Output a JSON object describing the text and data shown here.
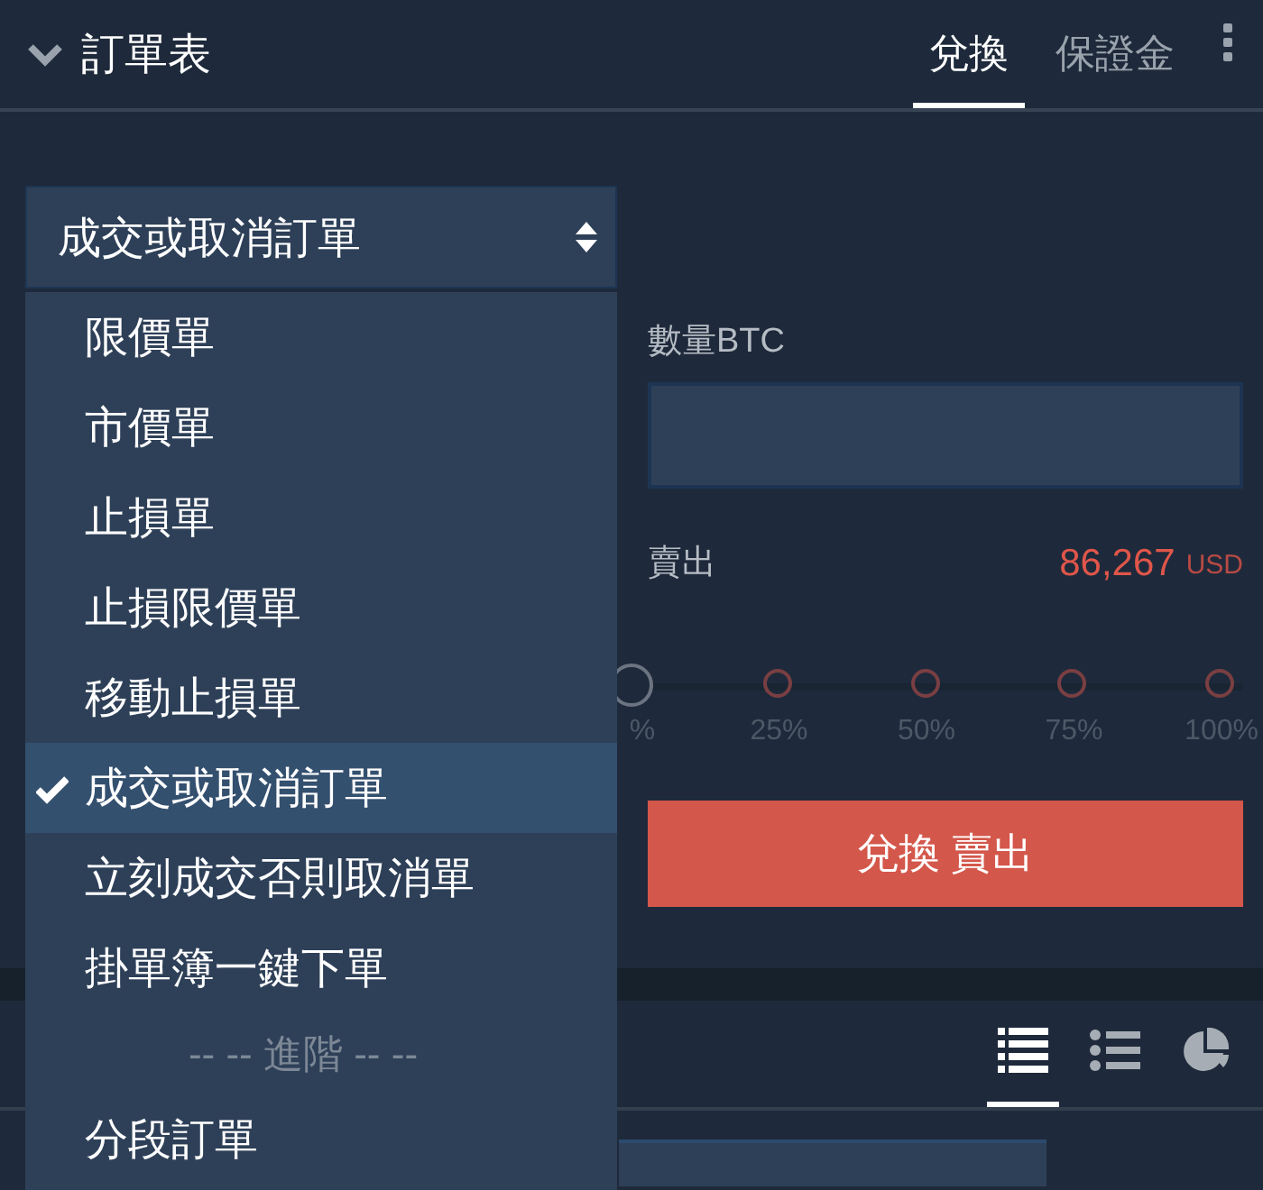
{
  "header": {
    "title": "訂單表",
    "tabs": [
      {
        "label": "兌換",
        "selected": true
      },
      {
        "label": "保證金",
        "selected": false
      }
    ]
  },
  "order_type_select": {
    "value": "成交或取消訂單",
    "expanded": true
  },
  "dropdown": {
    "items": [
      {
        "kind": "option",
        "label": "限價單",
        "selected": false
      },
      {
        "kind": "option",
        "label": "市價單",
        "selected": false
      },
      {
        "kind": "option",
        "label": "止損單",
        "selected": false
      },
      {
        "kind": "option",
        "label": "止損限價單",
        "selected": false
      },
      {
        "kind": "option",
        "label": "移動止損單",
        "selected": false
      },
      {
        "kind": "option",
        "label": "成交或取消訂單",
        "selected": true
      },
      {
        "kind": "option",
        "label": "立刻成交否則取消單",
        "selected": false
      },
      {
        "kind": "option",
        "label": "掛單簿一鍵下單",
        "selected": false
      },
      {
        "kind": "separator",
        "label": "-- -- 進階 -- --"
      },
      {
        "kind": "option",
        "label": "分段訂單",
        "selected": false
      }
    ]
  },
  "form": {
    "quantity_label": "數量BTC",
    "side_label": "賣出",
    "price": "86,267",
    "currency": "USD",
    "slider": {
      "level": 0,
      "ticks": [
        "%",
        "25%",
        "50%",
        "75%",
        "100%"
      ]
    },
    "submit_button": "兌換 賣出"
  },
  "bottom_panel": {
    "view_tabs": [
      {
        "kind": "table",
        "selected": true
      },
      {
        "kind": "list",
        "selected": false
      },
      {
        "kind": "pie",
        "selected": false
      }
    ]
  }
}
